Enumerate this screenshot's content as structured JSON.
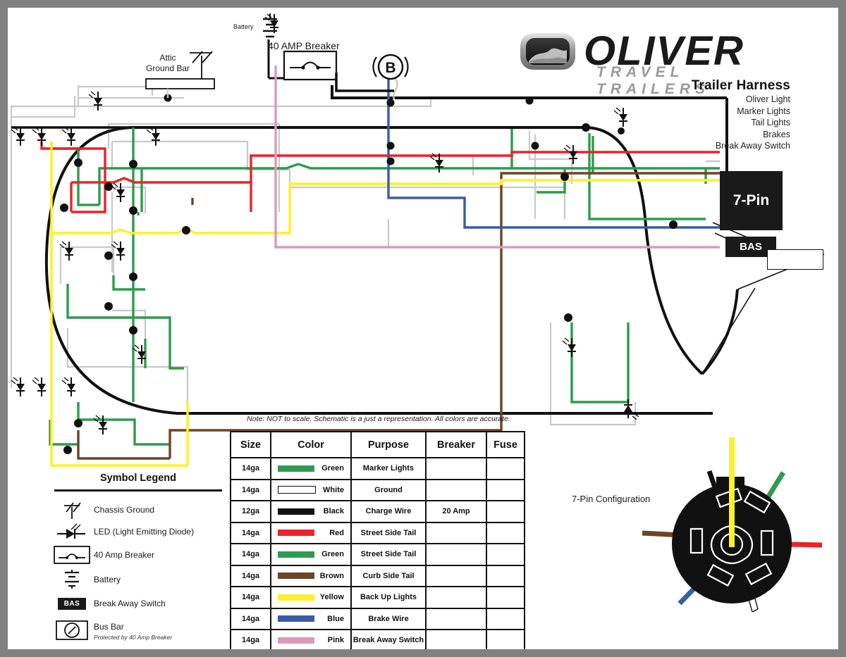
{
  "brand": {
    "name": "OLIVER",
    "tagline": "TRAVEL TRAILERS",
    "logo_icon": "oliver-oval-logo-icon"
  },
  "title_block": {
    "title": "Trailer Harness",
    "subtitles": [
      "Oliver Light",
      "Marker Lights",
      "Tail Lights",
      "Brakes",
      "Break Away Switch"
    ]
  },
  "diagram_labels": {
    "attic_ground_bar": "Attic\nGround Bar",
    "attic_ground_bar_line1": "Attic",
    "attic_ground_bar_line2": "Ground Bar",
    "battery": "Battery",
    "breaker_40amp": "40 AMP Breaker",
    "bus_bar_letter": "B",
    "connector_7pin": "7-Pin",
    "break_away_switch": "BAS"
  },
  "note": "Note:  NOT to scale.  Schematic is a just a representation.  All colors are accurate.",
  "symbol_legend": {
    "heading": "Symbol Legend",
    "items": [
      {
        "icon": "chassis-ground-icon",
        "label": "Chassis Ground",
        "sub": ""
      },
      {
        "icon": "led-diode-icon",
        "label": "LED (Light Emitting Diode)",
        "sub": ""
      },
      {
        "icon": "breaker-icon",
        "label": "40 Amp Breaker",
        "sub": ""
      },
      {
        "icon": "battery-icon",
        "label": "Battery",
        "sub": ""
      },
      {
        "icon": "bas-badge-icon",
        "label": "Break Away Switch",
        "sub": "",
        "badge": "BAS"
      },
      {
        "icon": "bus-bar-icon",
        "label": "Bus Bar",
        "sub": "Protected by 40 Amp Breaker"
      }
    ]
  },
  "wire_table": {
    "columns": [
      "Size",
      "Color",
      "Purpose",
      "Breaker",
      "Fuse"
    ],
    "rows": [
      {
        "size": "14ga",
        "color_name": "Green",
        "hex": "#2e9b4e",
        "purpose": "Marker Lights",
        "breaker": "",
        "fuse": ""
      },
      {
        "size": "14ga",
        "color_name": "White",
        "hex": "#ffffff",
        "purpose": "Ground",
        "breaker": "",
        "fuse": ""
      },
      {
        "size": "12ga",
        "color_name": "Black",
        "hex": "#111111",
        "purpose": "Charge Wire",
        "breaker": "20 Amp",
        "fuse": ""
      },
      {
        "size": "14ga",
        "color_name": "Red",
        "hex": "#ec2227",
        "purpose": "Street Side Tail",
        "breaker": "",
        "fuse": ""
      },
      {
        "size": "14ga",
        "color_name": "Green",
        "hex": "#2e9b4e",
        "purpose": "Street Side Tail",
        "breaker": "",
        "fuse": ""
      },
      {
        "size": "14ga",
        "color_name": "Brown",
        "hex": "#6b4524",
        "purpose": "Curb Side Tail",
        "breaker": "",
        "fuse": ""
      },
      {
        "size": "14ga",
        "color_name": "Yellow",
        "hex": "#fff02a",
        "purpose": "Back Up Lights",
        "breaker": "",
        "fuse": ""
      },
      {
        "size": "14ga",
        "color_name": "Blue",
        "hex": "#3a5ba8",
        "purpose": "Brake Wire",
        "breaker": "",
        "fuse": ""
      },
      {
        "size": "14ga",
        "color_name": "Pink",
        "hex": "#d99cb8",
        "purpose": "Break Away Switch",
        "breaker": "",
        "fuse": ""
      }
    ]
  },
  "pin_config": {
    "label": "7-Pin Configuration",
    "pins": [
      {
        "position": "center",
        "color_name": "Yellow",
        "hex": "#fff02a"
      },
      {
        "position": "top-left",
        "color_name": "Black",
        "hex": "#111111"
      },
      {
        "position": "top-right",
        "color_name": "Green",
        "hex": "#2e9b4e"
      },
      {
        "position": "right",
        "color_name": "Red",
        "hex": "#ec2227"
      },
      {
        "position": "left",
        "color_name": "Brown",
        "hex": "#6b4524"
      },
      {
        "position": "bottom-left",
        "color_name": "Blue",
        "hex": "#3a5ba8"
      },
      {
        "position": "bottom-right",
        "color_name": "White",
        "hex": "#ffffff"
      }
    ]
  },
  "colors": {
    "green": "#2e9b4e",
    "white_wire": "#ffffff",
    "white_wire_outline": "#b8b8b8",
    "black": "#111111",
    "red": "#ec2227",
    "brown": "#6b4524",
    "yellow": "#fff02a",
    "blue": "#3a5ba8",
    "pink": "#d99cb8",
    "frame": "#808080",
    "canvas": "#ffffff"
  }
}
